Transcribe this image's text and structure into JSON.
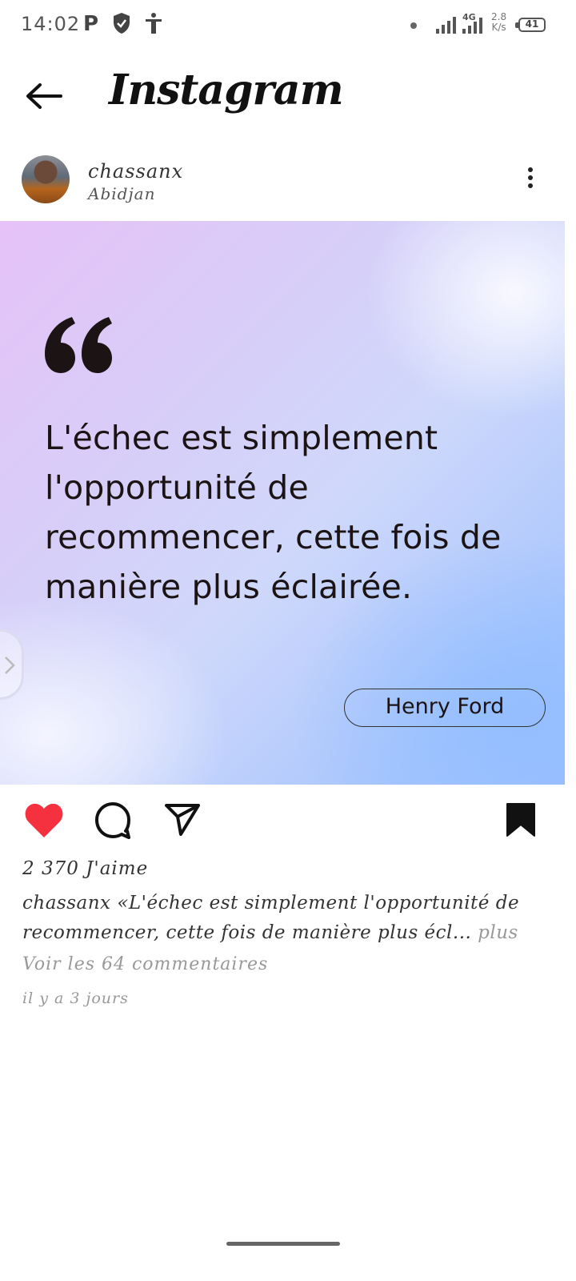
{
  "status_bar": {
    "time": "14:02",
    "p_badge": "P",
    "network_speed_value": "2.8",
    "network_speed_unit": "K/s",
    "network_type": "4G",
    "battery": "41"
  },
  "header": {
    "title": "Instagram"
  },
  "post": {
    "username": "chassanx",
    "location": "Abidjan",
    "quote": "L'échec est simplement l'opportunité de recommencer, cette fois de manière plus éclairée.",
    "author": "Henry Ford",
    "likes": "2 370 J'aime",
    "caption_user": "chassanx",
    "caption_text": " «L'échec est simplement l'opportunité de recommencer, cette fois de manière plus écl...",
    "caption_more": " plus",
    "comments_link": "Voir les 64 commentaires",
    "timestamp": "il y a 3 jours",
    "liked": true,
    "saved": true,
    "colors": {
      "like": "#f5303f",
      "gradient_start": "#e6c2f8",
      "gradient_end": "#9cc0ff"
    }
  }
}
